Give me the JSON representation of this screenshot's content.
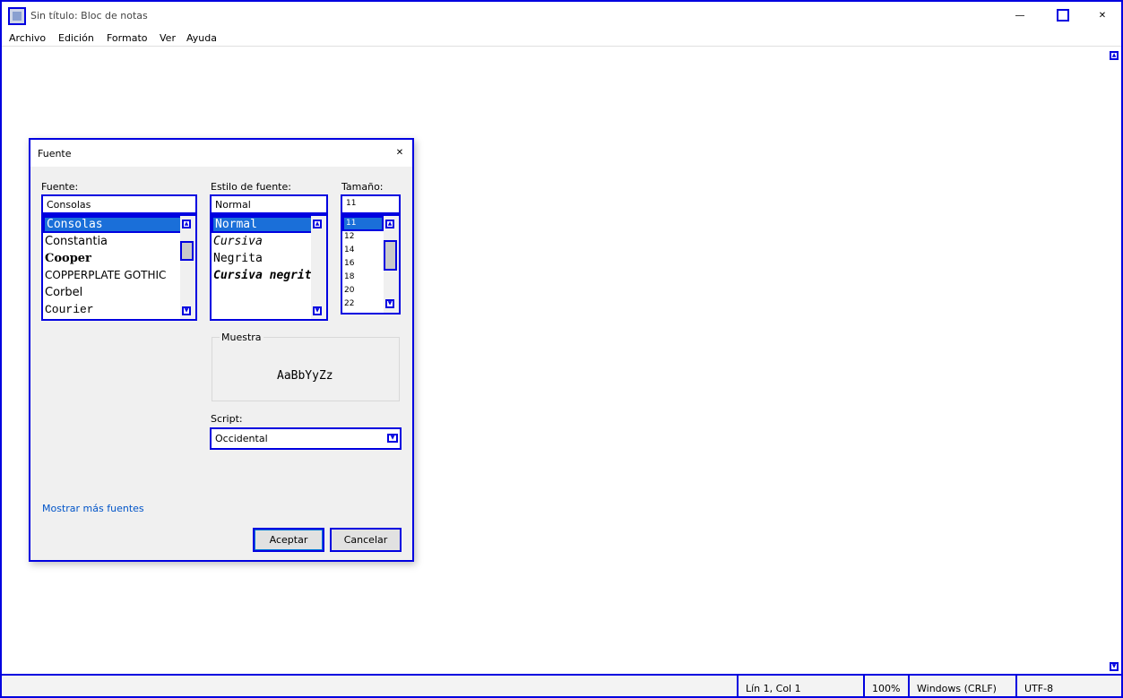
{
  "window": {
    "title": "Sin título: Bloc de notas",
    "minimize_glyph": "—",
    "close_glyph": "✕"
  },
  "menu": [
    "Archivo",
    "Edición",
    "Formato",
    "Ver",
    "Ayuda"
  ],
  "font_dialog": {
    "title": "Fuente",
    "close_glyph": "✕",
    "font_label": "Fuente:",
    "font_value": "Consolas",
    "fonts": [
      "Consolas",
      "Constantia",
      "Cooper",
      "COPPERPLATE GOTHIC",
      "Corbel",
      "Courier"
    ],
    "style_label": "Estilo de fuente:",
    "style_value": "Normal",
    "styles": [
      "Normal",
      "Cursiva",
      "Negrita",
      "Cursiva negrita"
    ],
    "size_label": "Tamaño:",
    "size_value": "11",
    "sizes": [
      "11",
      "12",
      "14",
      "16",
      "18",
      "20",
      "22"
    ],
    "sample_label": "Muestra",
    "sample_text": "AaBbYyZz",
    "script_label": "Script:",
    "script_value": "Occidental",
    "more_fonts_link": "Mostrar más fuentes",
    "ok_label": "Aceptar",
    "cancel_label": "Cancelar"
  },
  "status": {
    "position": "Lín 1, Col 1",
    "zoom": "100%",
    "line_ending": "Windows (CRLF)",
    "encoding": "UTF-8"
  },
  "colors": {
    "selection": "#1a6fd9",
    "link": "#0054c8",
    "dialog_bg": "#f0f0f0"
  }
}
